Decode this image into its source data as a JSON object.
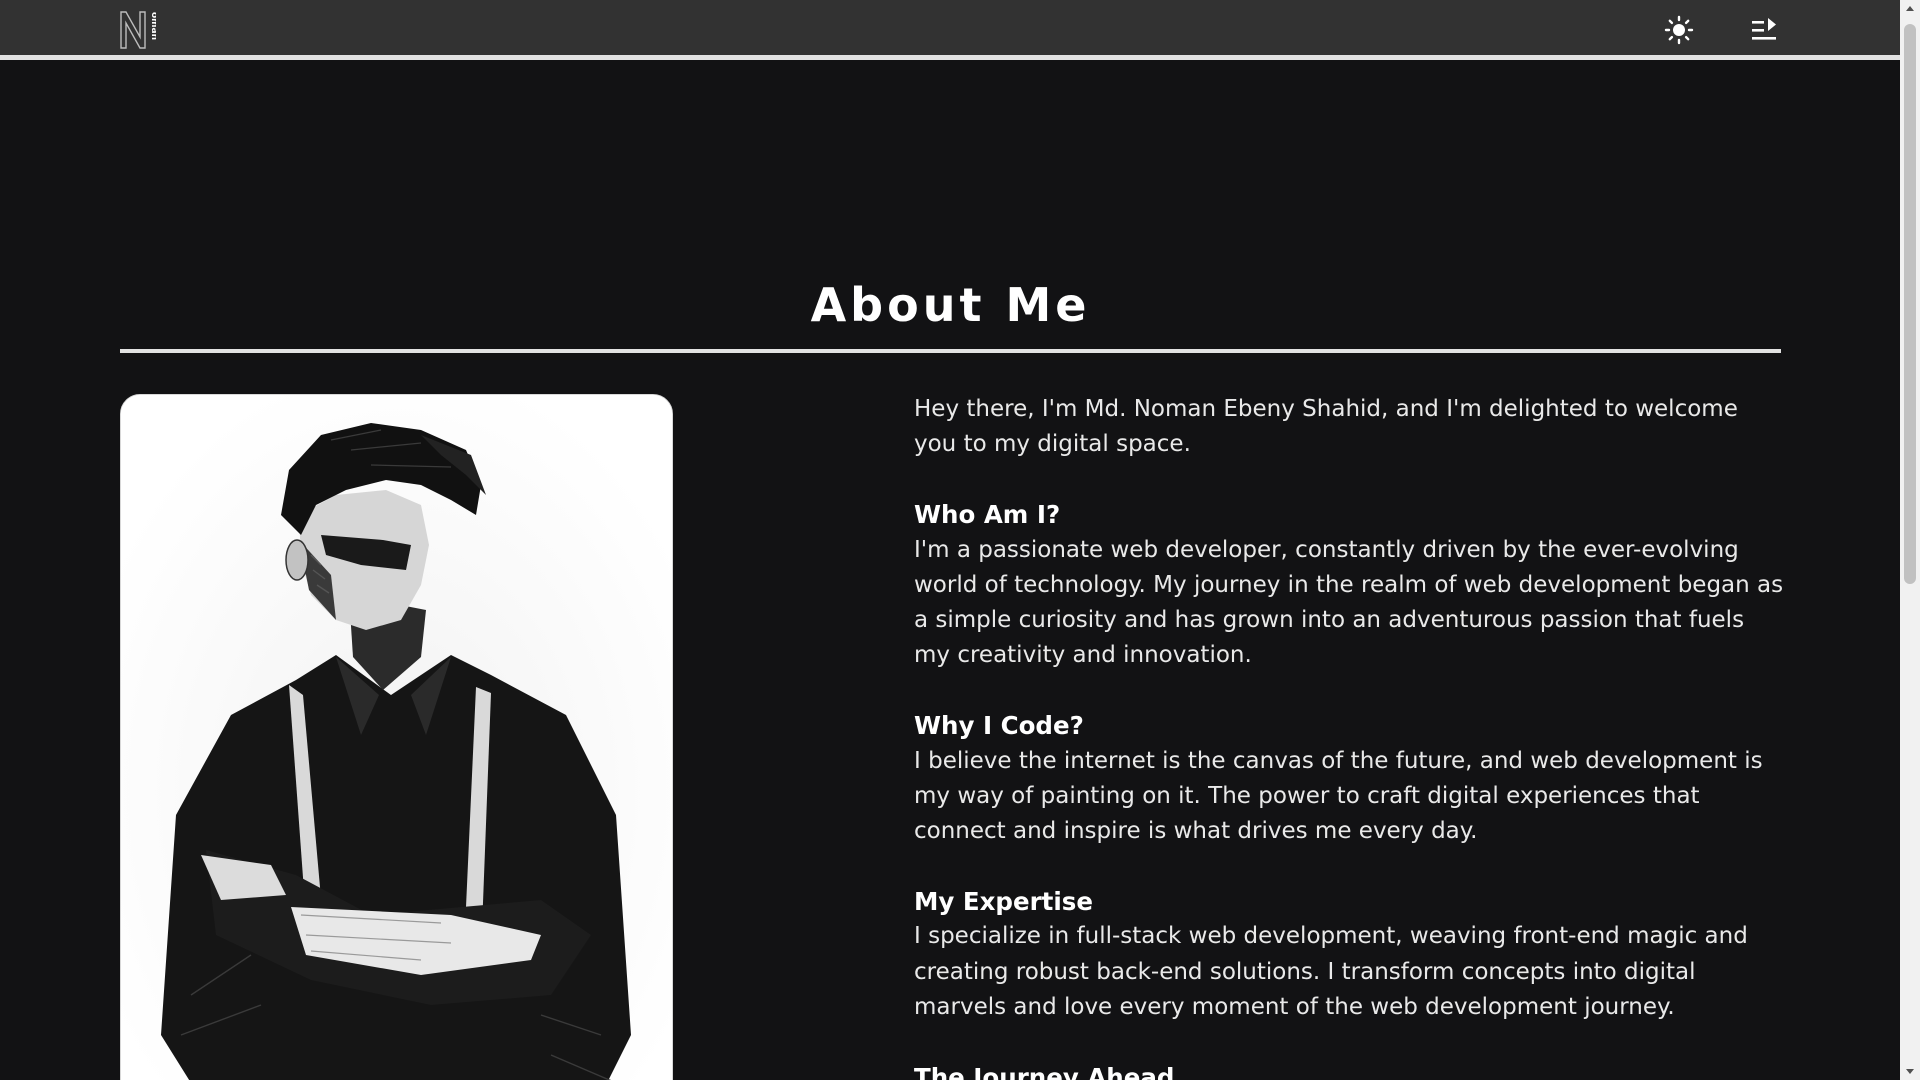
{
  "header": {
    "logo_text": "oman",
    "logo_initial": "N",
    "theme_icon": "sun-icon",
    "menu_icon": "menu-arrow-icon"
  },
  "about": {
    "title": "About Me",
    "intro": "Hey there, I'm Md. Noman Ebeny Shahid, and I'm delighted to welcome you to my digital space.",
    "sections": [
      {
        "heading": "Who Am I?",
        "body": "I'm a passionate web developer, constantly driven by the ever-evolving world of technology. My journey in the realm of web development began as a simple curiosity and has grown into an adventurous passion that fuels my creativity and innovation."
      },
      {
        "heading": "Why I Code?",
        "body": "I believe the internet is the canvas of the future, and web development is my way of painting on it. The power to craft digital experiences that connect and inspire is what drives me every day."
      },
      {
        "heading": "My Expertise",
        "body": "I specialize in full-stack web development, weaving front-end magic and creating robust back-end solutions. I transform concepts into digital marvels and love every moment of the web development journey."
      },
      {
        "heading": "The Journey Ahead"
      }
    ]
  },
  "colors": {
    "page_bg": "#121214",
    "header_bg": "#323232",
    "text": "#e9e9e9",
    "accent_rule": "#e2e2e2"
  }
}
